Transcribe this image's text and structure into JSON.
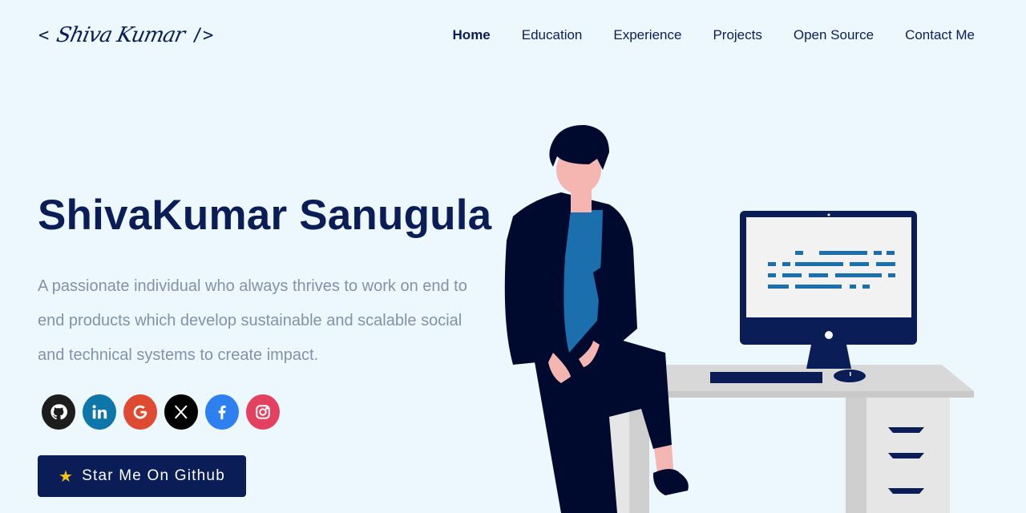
{
  "header": {
    "logo": {
      "open": "<",
      "signature": "Shiva Kumar",
      "close": "/>"
    },
    "nav": [
      {
        "label": "Home",
        "active": true
      },
      {
        "label": "Education",
        "active": false
      },
      {
        "label": "Experience",
        "active": false
      },
      {
        "label": "Projects",
        "active": false
      },
      {
        "label": "Open Source",
        "active": false
      },
      {
        "label": "Contact Me",
        "active": false
      }
    ]
  },
  "hero": {
    "title": "ShivaKumar Sanugula",
    "subtitle": "A passionate individual who always thrives to work on end to end products which develop sustainable and scalable social and technical systems to create impact.",
    "socials": [
      {
        "icon": "github-icon",
        "color": "#1d1d1d"
      },
      {
        "icon": "linkedin-icon",
        "color": "#0e76a8"
      },
      {
        "icon": "google-icon",
        "color": "#df4a32"
      },
      {
        "icon": "x-twitter-icon",
        "color": "#000000"
      },
      {
        "icon": "facebook-icon",
        "color": "#2e7ff0"
      },
      {
        "icon": "instagram-icon",
        "color": "#e4405f"
      }
    ],
    "cta": {
      "icon": "star-icon",
      "label": "Star Me On Github"
    }
  },
  "colors": {
    "background": "#edf8fe",
    "primary": "#0a1d56",
    "subtitle": "#8391aa",
    "accent_blue": "#1c6fad"
  }
}
